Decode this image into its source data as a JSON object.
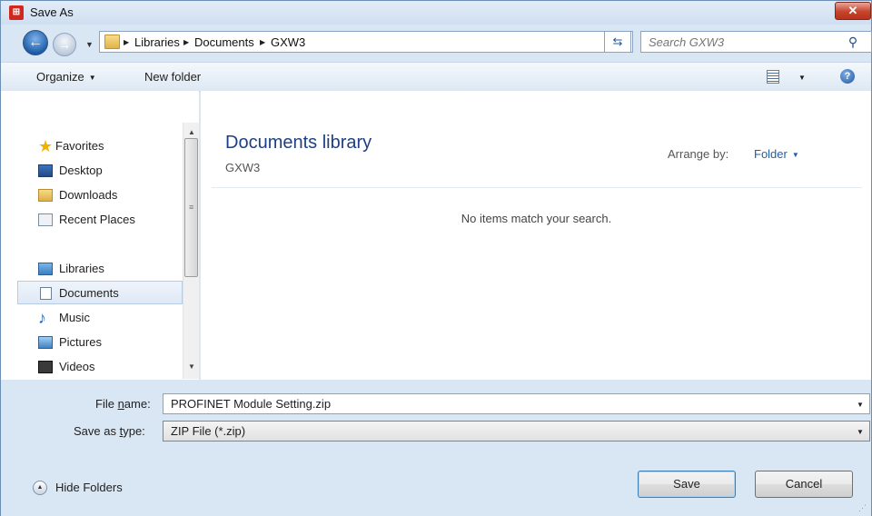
{
  "window": {
    "title": "Save As",
    "close_label": "✕"
  },
  "navigation": {
    "back_icon": "back-arrow-icon",
    "forward_icon": "forward-arrow-icon",
    "breadcrumbs": [
      "Libraries",
      "Documents",
      "GXW3"
    ],
    "refresh_icon": "refresh-icon",
    "search_placeholder": "Search GXW3"
  },
  "toolbar": {
    "organize_label": "Organize",
    "new_folder_label": "New folder",
    "help_icon": "help-icon",
    "views_icon": "views-icon"
  },
  "nav_pane": {
    "favorites_label": "Favorites",
    "favorites": [
      "Desktop",
      "Downloads",
      "Recent Places"
    ],
    "libraries_label": "Libraries",
    "libraries": [
      "Documents",
      "Music",
      "Pictures",
      "Videos"
    ],
    "selected": "Documents"
  },
  "content": {
    "library_title": "Documents library",
    "library_subtitle": "GXW3",
    "arrange_by_label": "Arrange by:",
    "arrange_by_value": "Folder",
    "empty_message": "No items match your search."
  },
  "form": {
    "file_name_label_pre": "File ",
    "file_name_label_mnemonic": "n",
    "file_name_label_post": "ame:",
    "file_name_value": "PROFINET Module Setting.zip",
    "save_type_label_pre": "Save as ",
    "save_type_label_mnemonic": "t",
    "save_type_label_post": "ype:",
    "save_type_value": "ZIP File (*.zip)"
  },
  "footer": {
    "hide_folders_label": "Hide Folders",
    "save_label": "Save",
    "cancel_label": "Cancel"
  },
  "colors": {
    "accent": "#1e3f84",
    "link": "#1f5ea8",
    "frame": "#d9e6f4"
  }
}
